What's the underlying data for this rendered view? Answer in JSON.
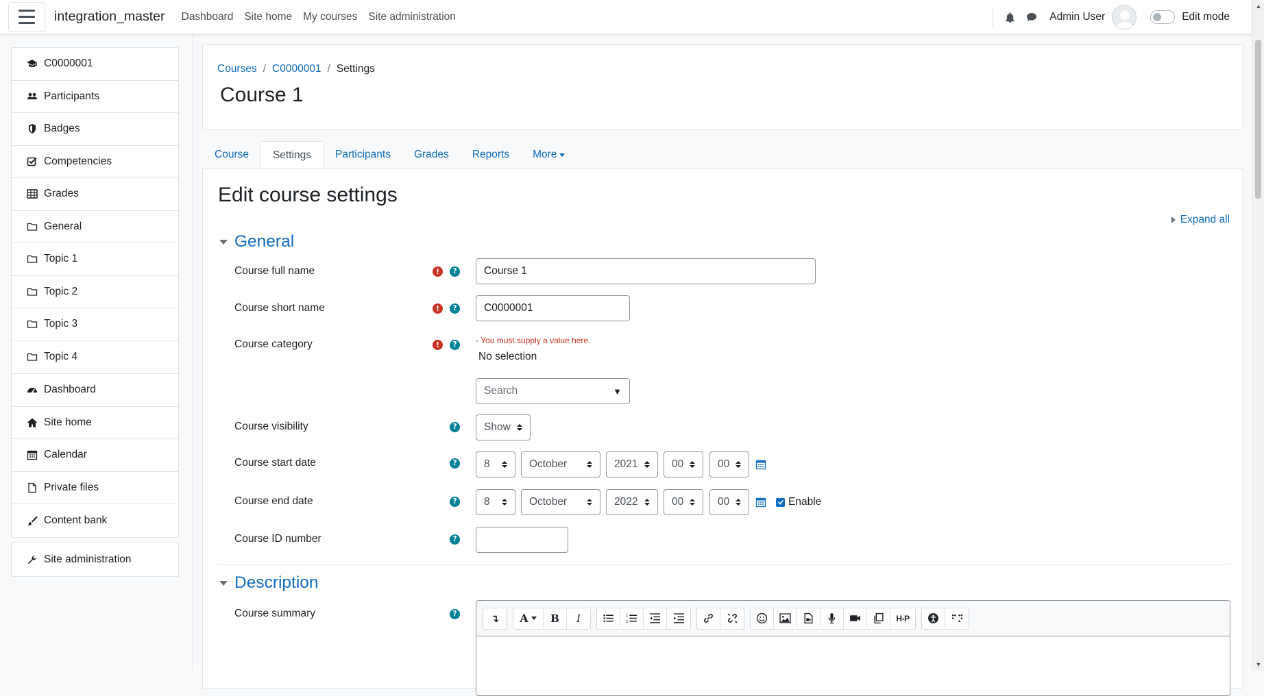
{
  "navbar": {
    "site_name": "integration_master",
    "links": [
      "Dashboard",
      "Site home",
      "My courses",
      "Site administration"
    ],
    "user_name": "Admin User",
    "edit_mode_label": "Edit mode",
    "edit_mode_on": false
  },
  "drawer": {
    "course_items": [
      {
        "label": "C0000001",
        "icon": "graduation-cap-icon"
      },
      {
        "label": "Participants",
        "icon": "users-icon"
      },
      {
        "label": "Badges",
        "icon": "shield-icon"
      },
      {
        "label": "Competencies",
        "icon": "checkbox-icon"
      },
      {
        "label": "Grades",
        "icon": "table-icon"
      },
      {
        "label": "General",
        "icon": "folder-icon"
      },
      {
        "label": "Topic 1",
        "icon": "folder-icon"
      },
      {
        "label": "Topic 2",
        "icon": "folder-icon"
      },
      {
        "label": "Topic 3",
        "icon": "folder-icon"
      },
      {
        "label": "Topic 4",
        "icon": "folder-icon"
      }
    ],
    "site_items": [
      {
        "label": "Dashboard",
        "icon": "tachometer-icon"
      },
      {
        "label": "Site home",
        "icon": "home-icon"
      },
      {
        "label": "Calendar",
        "icon": "calendar-icon"
      },
      {
        "label": "Private files",
        "icon": "file-icon"
      },
      {
        "label": "Content bank",
        "icon": "paint-brush-icon"
      }
    ],
    "admin_items": [
      {
        "label": "Site administration",
        "icon": "wrench-icon"
      }
    ]
  },
  "header": {
    "breadcrumb": [
      "Courses",
      "C0000001",
      "Settings"
    ],
    "title": "Course 1"
  },
  "tabs": [
    "Course",
    "Settings",
    "Participants",
    "Grades",
    "Reports",
    "More"
  ],
  "active_tab": "Settings",
  "form": {
    "heading": "Edit course settings",
    "expand_all": "Expand all",
    "general_section": "General",
    "fields": {
      "fullname_label": "Course full name",
      "fullname_value": "Course 1",
      "shortname_label": "Course short name",
      "shortname_value": "C0000001",
      "category_label": "Course category",
      "category_error": "- You must supply a value here.",
      "category_selection": "No selection",
      "category_search_placeholder": "Search",
      "visibility_label": "Course visibility",
      "visibility_value": "Show",
      "startdate_label": "Course start date",
      "startdate": {
        "day": "8",
        "month": "October",
        "year": "2021",
        "hour": "00",
        "minute": "00"
      },
      "enddate_label": "Course end date",
      "enddate": {
        "day": "8",
        "month": "October",
        "year": "2022",
        "hour": "00",
        "minute": "00"
      },
      "enddate_enable_label": "Enable",
      "enddate_enabled": true,
      "idnumber_label": "Course ID number",
      "idnumber_value": ""
    },
    "description_section": "Description",
    "summary_label": "Course summary"
  },
  "colors": {
    "link": "#0f6cbf",
    "required": "#ca3120",
    "help": "#008196"
  }
}
